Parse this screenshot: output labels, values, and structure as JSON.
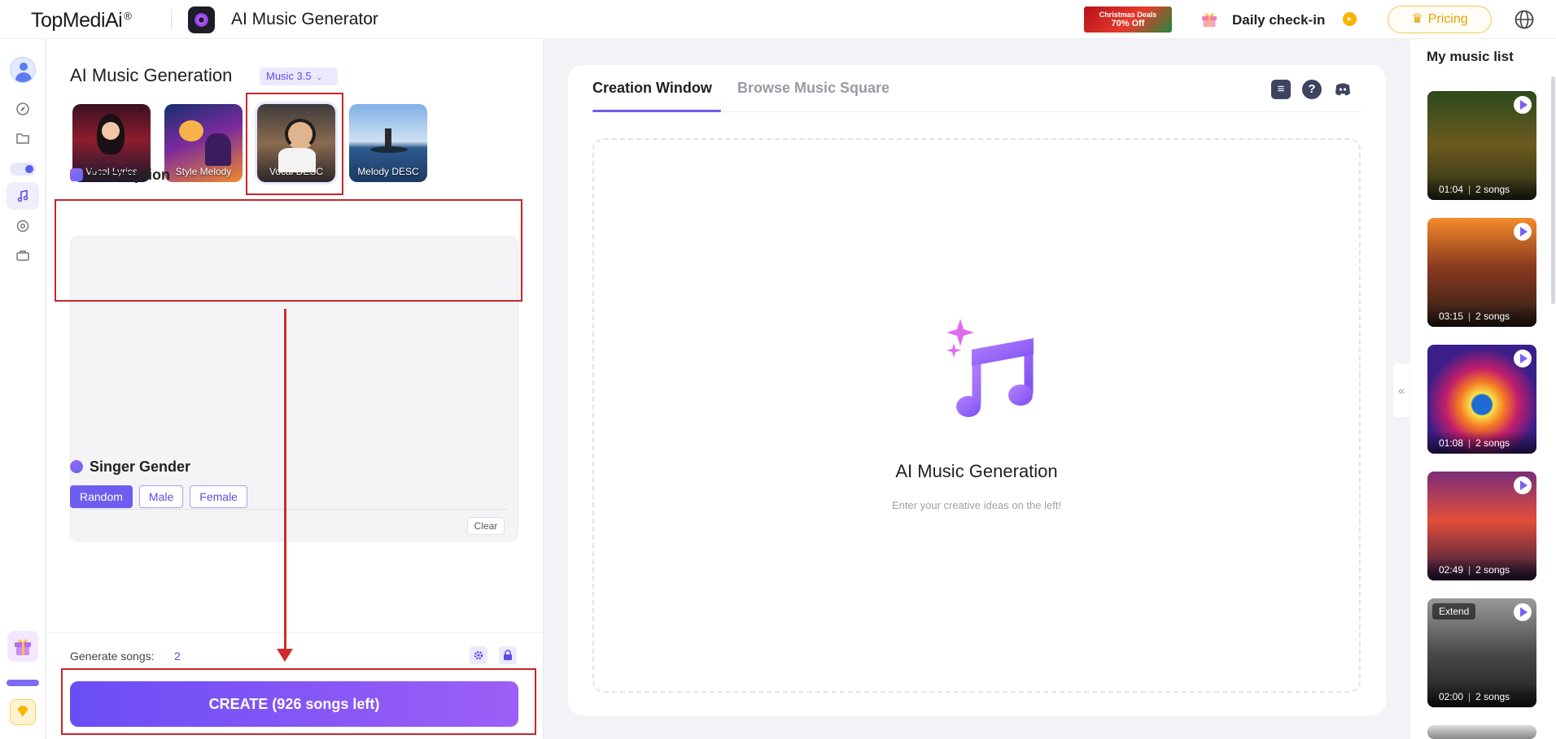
{
  "header": {
    "logo_text": "TopMediAi",
    "logo_mark": "®",
    "app_title": "AI Music Generator",
    "promo_line1": "Christmas Deals",
    "promo_line2": "70% Off",
    "checkin_label": "Daily check-in",
    "pricing_label": "Pricing"
  },
  "panel": {
    "title": "AI Music Generation",
    "version": "Music 3.5",
    "modes": [
      {
        "label": "Vocal Lyrics",
        "selected": false
      },
      {
        "label": "Style Melody",
        "selected": false
      },
      {
        "label": "Vocal DESC",
        "selected": true
      },
      {
        "label": "Melody DESC",
        "selected": false
      }
    ],
    "description_heading": "Description",
    "description_value": "",
    "clear_label": "Clear",
    "gender_heading": "Singer Gender",
    "gender_options": [
      "Random",
      "Male",
      "Female"
    ],
    "gender_selected": "Random",
    "generate_label": "Generate songs:",
    "generate_count": "2",
    "create_label": "CREATE (926 songs left)"
  },
  "center": {
    "tabs": [
      "Creation Window",
      "Browse Music Square"
    ],
    "active_tab": "Creation Window",
    "empty_title": "AI Music Generation",
    "empty_subtitle": "Enter your creative ideas on the left!"
  },
  "music_list": {
    "title": "My music list",
    "items": [
      {
        "duration": "01:04",
        "songs": "2 songs",
        "extend": ""
      },
      {
        "duration": "03:15",
        "songs": "2 songs",
        "extend": ""
      },
      {
        "duration": "01:08",
        "songs": "2 songs",
        "extend": ""
      },
      {
        "duration": "02:49",
        "songs": "2 songs",
        "extend": ""
      },
      {
        "duration": "02:00",
        "songs": "2 songs",
        "extend": "Extend"
      }
    ]
  },
  "colors": {
    "accent": "#6d5df0",
    "annotation_red": "#c9252c",
    "pricing_gold": "#e3a100"
  },
  "icons": [
    "gift-icon",
    "coin-icon",
    "crown-icon",
    "globe-icon",
    "music-note-icon",
    "sparkle-icon",
    "task-list-icon",
    "help-icon",
    "discord-icon",
    "play-icon",
    "settings-icon",
    "lock-icon"
  ]
}
